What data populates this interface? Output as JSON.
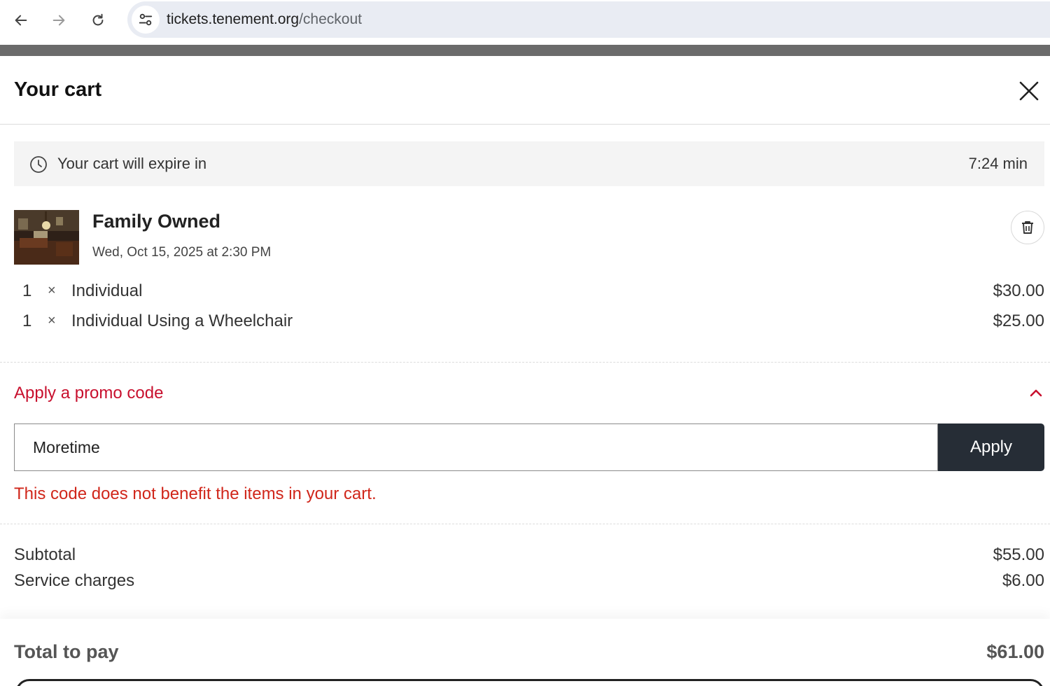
{
  "browser": {
    "url_host": "tickets.tenement.org",
    "url_path": "/checkout"
  },
  "cart": {
    "title": "Your cart",
    "timer": {
      "label": "Your cart will expire in",
      "value": "7:24 min"
    },
    "event": {
      "title": "Family Owned",
      "date": "Wed, Oct 15, 2025 at 2:30 PM"
    },
    "items": [
      {
        "qty": "1",
        "times": "×",
        "name": "Individual",
        "price": "$30.00"
      },
      {
        "qty": "1",
        "times": "×",
        "name": "Individual Using a Wheelchair",
        "price": "$25.00"
      }
    ],
    "promo": {
      "toggle_label": "Apply a promo code",
      "input_value": "Moretime",
      "apply_label": "Apply",
      "error": "This code does not benefit the items in your cart."
    },
    "summary": {
      "subtotal_label": "Subtotal",
      "subtotal_value": "$55.00",
      "service_label": "Service charges",
      "service_value": "$6.00"
    },
    "total": {
      "label": "Total to pay",
      "value": "$61.00"
    }
  },
  "icons": {
    "back": "arrow-left-icon",
    "forward": "arrow-right-icon",
    "reload": "reload-icon",
    "site_info": "tune-icon",
    "close": "close-icon",
    "timer": "clock-icon",
    "delete": "trash-icon",
    "promo_toggle": "chevron-up-icon"
  },
  "colors": {
    "accent_red": "#c8102e",
    "error_red": "#d0261a",
    "apply_button_bg": "#262d36",
    "timer_bg": "#f4f4f4",
    "omnibox_bg": "#e9ecf3"
  }
}
